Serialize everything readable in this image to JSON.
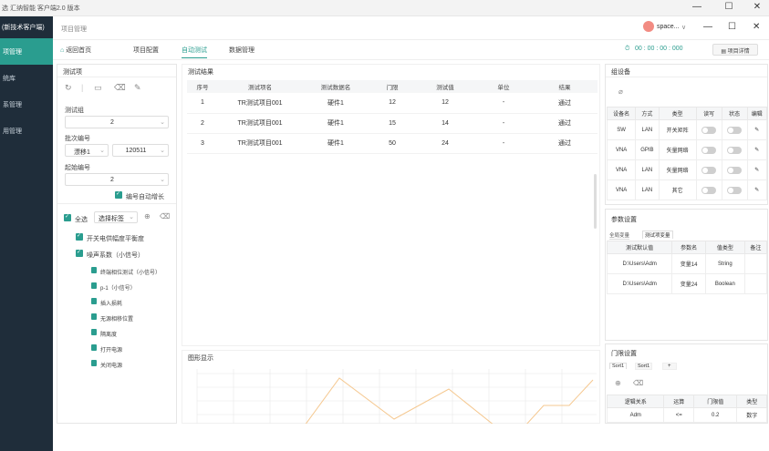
{
  "window": {
    "title": "选 汇纳智能 客户端2.0 版本",
    "min": "—",
    "max": "☐",
    "close": "✕"
  },
  "sidebar": {
    "brand": "(新技术客户端)",
    "items": [
      {
        "label": "项管理",
        "active": true
      },
      {
        "label": "统库",
        "active": false
      },
      {
        "label": "系管理",
        "active": false
      },
      {
        "label": "用管理",
        "active": false
      }
    ]
  },
  "topbar": {
    "breadcrumb": "项目管理",
    "user": "space...",
    "user_chevron": "∨",
    "min": "—",
    "max": "☐",
    "close": "✕"
  },
  "tabs": [
    {
      "label": "返回首页",
      "icon": "home-icon"
    },
    {
      "label": "项目配置"
    },
    {
      "label": "自动测试",
      "active": true
    },
    {
      "label": "数据管理"
    }
  ],
  "timer": {
    "value": "00 : 00 : 00 : 000",
    "button": "项目详情"
  },
  "test_panel": {
    "title": "测试项",
    "fields": [
      {
        "label": "测试组",
        "value": "2"
      },
      {
        "label": "批次编号",
        "value1": "漂移1",
        "value2": "120511"
      },
      {
        "label": "起始编号",
        "value": "2"
      }
    ],
    "auto_increment": "编号自动增长",
    "select_all": "全选",
    "tag_select": "选择标签",
    "tree": [
      {
        "label": "开关电供幅度平衡度",
        "level": 1
      },
      {
        "label": "噪声系数（小信号）",
        "level": 1
      },
      {
        "label": "终端相位测试（小信号）",
        "level": 2
      },
      {
        "label": "p-1（小信号）",
        "level": 2
      },
      {
        "label": "插入损耗",
        "level": 2
      },
      {
        "label": "无源相移位置",
        "level": 2
      },
      {
        "label": "隔离度",
        "level": 2
      },
      {
        "label": "打开电源",
        "level": 2
      },
      {
        "label": "关闭电源",
        "level": 2
      }
    ]
  },
  "results": {
    "title": "测试结果",
    "columns": [
      "序号",
      "测试项名",
      "测试数据名",
      "门限",
      "测试值",
      "单位",
      "结果"
    ],
    "rows": [
      [
        "1",
        "TR测试项目001",
        "硬件1",
        "12",
        "12",
        "-",
        "通过"
      ],
      [
        "2",
        "TR测试项目001",
        "硬件1",
        "15",
        "14",
        "-",
        "通过"
      ],
      [
        "3",
        "TR测试项目001",
        "硬件1",
        "50",
        "24",
        "-",
        "通过"
      ]
    ]
  },
  "graph": {
    "title": "图形显示"
  },
  "device_panel": {
    "title": "组设备",
    "columns": [
      "设备名",
      "方式",
      "类型",
      "读写",
      "状态",
      "编辑"
    ],
    "rows": [
      [
        "SW",
        "LAN",
        "开关矩阵"
      ],
      [
        "VNA",
        "GPIB",
        "矢量网络"
      ],
      [
        "VNA",
        "LAN",
        "矢量网络"
      ],
      [
        "VNA",
        "LAN",
        "其它"
      ]
    ]
  },
  "param_panel": {
    "title": "参数设置",
    "tabs": [
      "全局变量",
      "测试项变量"
    ],
    "columns": [
      "测试默认值",
      "参数名",
      "值类型",
      "备注"
    ],
    "rows": [
      [
        "D:\\Users\\Adm",
        "变量14",
        "String",
        ""
      ],
      [
        "D:\\Users\\Adm",
        "变量24",
        "Boolean",
        ""
      ]
    ]
  },
  "limit_panel": {
    "title": "门限设置",
    "tabs": [
      "Sort1",
      "Sort1",
      "+"
    ],
    "columns": [
      "逻辑关系",
      "运算",
      "门限值",
      "类型"
    ],
    "rows": [
      [
        "Adm",
        "<=",
        "0.2",
        "数字"
      ]
    ]
  },
  "colors": {
    "accent": "#2a9d8f",
    "sidebar": "#1f2d3a",
    "link": "#3b82f6",
    "line": "#f5c890"
  }
}
